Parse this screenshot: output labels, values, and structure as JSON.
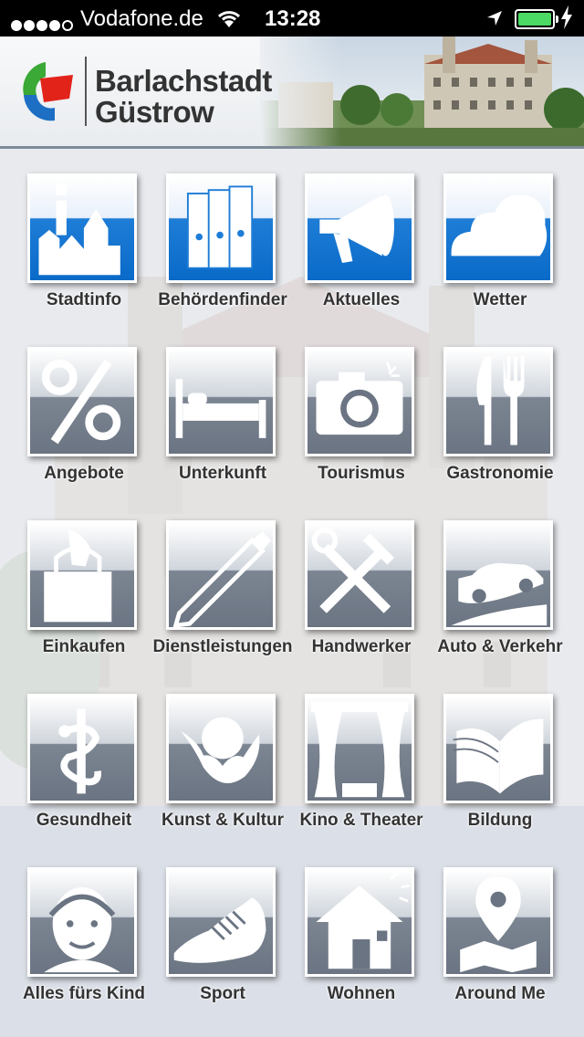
{
  "status_bar": {
    "carrier": "Vodafone.de",
    "time": "13:28",
    "icons": [
      "signal-dots-icon",
      "wifi-icon",
      "location-arrow-icon",
      "battery-icon",
      "charging-bolt-icon"
    ]
  },
  "header": {
    "brand_line1": "Barlachstadt",
    "brand_line2": "Güstrow",
    "logo_colors": {
      "green": "#3aa935",
      "red": "#e2231a",
      "blue": "#1d6fc4"
    }
  },
  "tiles": [
    {
      "label": "Stadtinfo",
      "icon": "info-city-icon",
      "style": "blue"
    },
    {
      "label": "Behördenfinder",
      "icon": "binders-icon",
      "style": "blue"
    },
    {
      "label": "Aktuelles",
      "icon": "megaphone-icon",
      "style": "blue"
    },
    {
      "label": "Wetter",
      "icon": "cloud-icon",
      "style": "blue"
    },
    {
      "label": "Angebote",
      "icon": "percent-icon",
      "style": "grey"
    },
    {
      "label": "Unterkunft",
      "icon": "bed-icon",
      "style": "grey"
    },
    {
      "label": "Tourismus",
      "icon": "camera-icon",
      "style": "grey"
    },
    {
      "label": "Gastronomie",
      "icon": "knife-fork-icon",
      "style": "grey"
    },
    {
      "label": "Einkaufen",
      "icon": "shopping-bag-icon",
      "style": "grey"
    },
    {
      "label": "Dienstleistungen",
      "icon": "pencil-icon",
      "style": "grey"
    },
    {
      "label": "Handwerker",
      "icon": "hammer-wrench-icon",
      "style": "grey"
    },
    {
      "label": "Auto & Verkehr",
      "icon": "car-icon",
      "style": "grey"
    },
    {
      "label": "Gesundheit",
      "icon": "aesculapius-icon",
      "style": "grey"
    },
    {
      "label": "Kunst & Kultur",
      "icon": "cherub-icon",
      "style": "grey"
    },
    {
      "label": "Kino & Theater",
      "icon": "stage-curtain-icon",
      "style": "grey"
    },
    {
      "label": "Bildung",
      "icon": "open-book-icon",
      "style": "grey"
    },
    {
      "label": "Alles fürs Kind",
      "icon": "child-face-icon",
      "style": "grey"
    },
    {
      "label": "Sport",
      "icon": "sneaker-icon",
      "style": "grey"
    },
    {
      "label": "Wohnen",
      "icon": "house-sun-icon",
      "style": "grey"
    },
    {
      "label": "Around Me",
      "icon": "map-pin-icon",
      "style": "grey"
    }
  ]
}
